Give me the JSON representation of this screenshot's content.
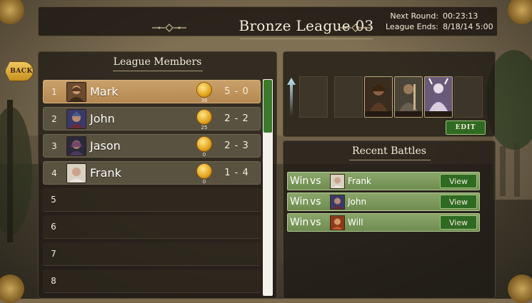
{
  "header": {
    "title": "Bronze League 03",
    "next_round_label": "Next Round:",
    "next_round_value": "00:23:13",
    "league_ends_label": "League Ends:",
    "league_ends_value": "8/18/14 5:00"
  },
  "back_label": "BACK",
  "members": {
    "title": "League Members",
    "rows": [
      {
        "rank": "1",
        "name": "Mark",
        "coins": "36",
        "score": "5 - 0"
      },
      {
        "rank": "2",
        "name": "John",
        "coins": "25",
        "score": "2 - 2"
      },
      {
        "rank": "3",
        "name": "Jason",
        "coins": "0",
        "score": "2 - 3"
      },
      {
        "rank": "4",
        "name": "Frank",
        "coins": "0",
        "score": "1 - 4"
      }
    ],
    "empty_ranks": [
      "5",
      "6",
      "7",
      "8"
    ]
  },
  "deck": {
    "edit_label": "EDIT"
  },
  "battles": {
    "title": "Recent Battles",
    "items": [
      {
        "result": "Win",
        "vs": "vs",
        "opponent": "Frank",
        "view_label": "View"
      },
      {
        "result": "Win",
        "vs": "vs",
        "opponent": "John",
        "view_label": "View"
      },
      {
        "result": "Win",
        "vs": "vs",
        "opponent": "Will",
        "view_label": "View"
      }
    ]
  },
  "colors": {
    "accent_gold": "#c9a06a",
    "button_green": "#2f6a22",
    "battle_row_green": "#7d9a5e",
    "scroll_thumb": "#3a7a2a"
  }
}
